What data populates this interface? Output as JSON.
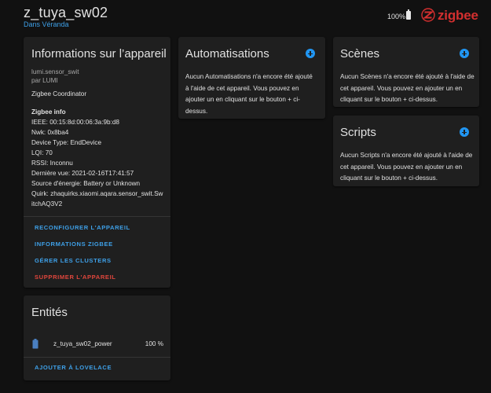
{
  "header": {
    "title": "z_tuya_sw02",
    "subtitle": "Dans Véranda",
    "battery": "100%",
    "brand": "zigbee"
  },
  "device_info": {
    "heading": "Informations sur l’appareil",
    "model": "lumi.sensor_swit",
    "manufacturer": "par LUMI",
    "coordinator": "Zigbee Coordinator",
    "zigbee_heading": "Zigbee info",
    "ieee": "IEEE: 00:15:8d:00:06:3a:9b:d8",
    "nwk": "Nwk: 0x8ba4",
    "device_type": "Device Type: EndDevice",
    "lqi": "LQI: 70",
    "rssi": "RSSI: Inconnu",
    "last_seen": "Dernière vue: 2021-02-16T17:41:57",
    "power_source": "Source d'énergie: Battery or Unknown",
    "quirk_line1": "Quirk: zhaquirks.xiaomi.aqara.sensor_swit.Sw",
    "quirk_line2": "itchAQ3V2",
    "actions": {
      "reconfigure": "RECONFIGURER L'APPAREIL",
      "zigbee_info": "INFORMATIONS ZIGBEE",
      "clusters": "GÉRER LES CLUSTERS",
      "delete": "SUPPRIMER L'APPAREIL"
    }
  },
  "entities": {
    "heading": "Entités",
    "entity_name": "z_tuya_sw02_power",
    "entity_value": "100 %",
    "add_lovelace": "AJOUTER À LOVELACE"
  },
  "automations": {
    "heading": "Automatisations",
    "line1": "Aucun Automatisations n'a encore été ajouté",
    "line2": "à l'aide de cet appareil. Vous pouvez en",
    "line3": "ajouter un en cliquant sur le bouton + ci-",
    "line4": "dessus."
  },
  "scenes": {
    "heading": "Scènes",
    "line1": "Aucun Scènes n'a encore été ajouté à l'aide de",
    "line2": "cet appareil. Vous pouvez en ajouter un en",
    "line3": "cliquant sur le bouton + ci-dessus."
  },
  "scripts": {
    "heading": "Scripts",
    "line1": "Aucun Scripts n'a encore été ajouté à l'aide de",
    "line2": "cet appareil. Vous pouvez en ajouter un en",
    "line3": "cliquant sur le bouton + ci-dessus."
  },
  "colors": {
    "accent": "#2196f3",
    "link": "#3ea0e8",
    "danger": "#e0463c",
    "brand": "#d32f2f",
    "card": "#1f1f1f",
    "background": "#111111"
  },
  "icons": [
    "battery-icon",
    "zigbee-logo-icon",
    "add-icon"
  ]
}
